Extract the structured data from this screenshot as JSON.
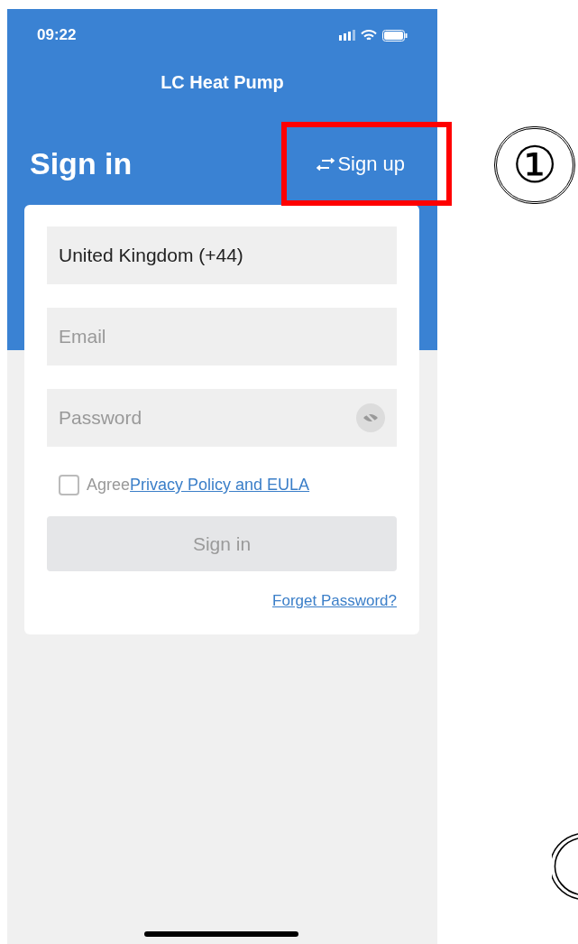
{
  "status_bar": {
    "time": "09:22"
  },
  "app_title": "LC Heat Pump",
  "heading": "Sign in",
  "switch_link": {
    "label": "Sign up",
    "highlighted": true
  },
  "form": {
    "country": {
      "value": "United Kingdom (+44)"
    },
    "email": {
      "placeholder": "Email"
    },
    "password": {
      "placeholder": "Password"
    },
    "agreement": {
      "checked": false,
      "prefix": "Agree",
      "link": "Privacy Policy and EULA"
    },
    "submit": {
      "label": "Sign in",
      "disabled": true
    },
    "forgot_link": "Forget Password?"
  },
  "annotations": [
    {
      "label": "①"
    }
  ]
}
